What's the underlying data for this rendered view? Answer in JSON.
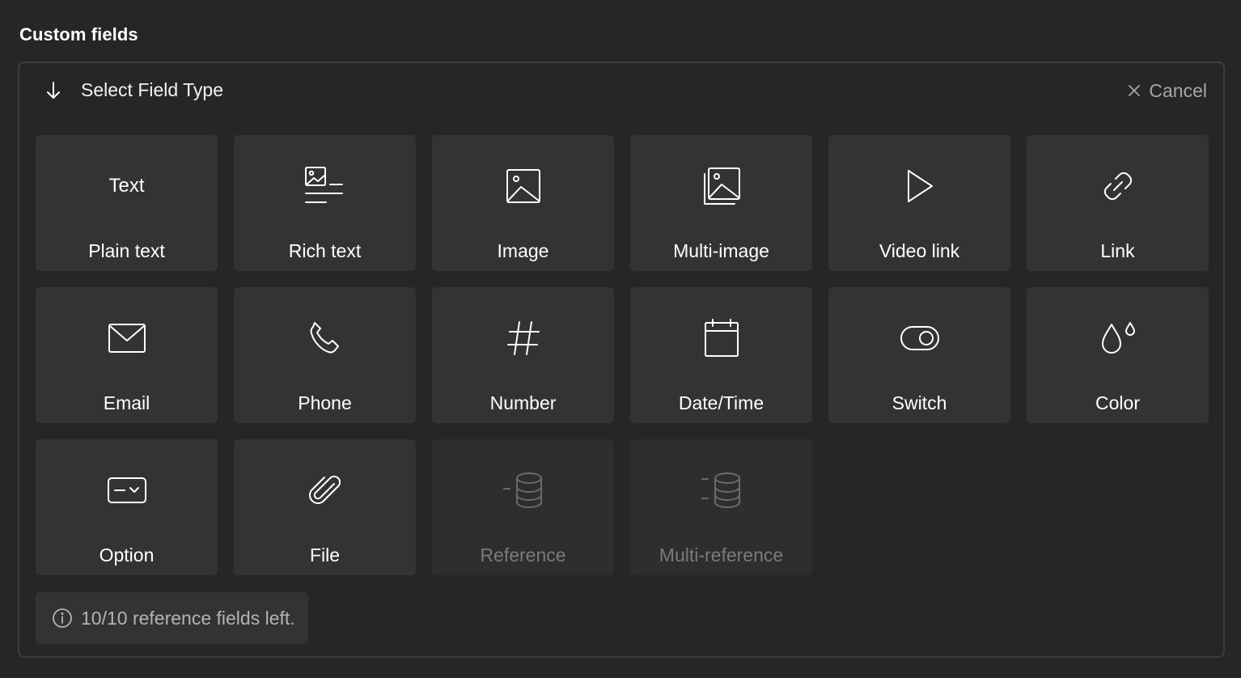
{
  "section_title": "Custom fields",
  "header": {
    "title": "Select Field Type",
    "arrow_icon": "arrow-down-icon",
    "cancel_label": "Cancel",
    "cancel_icon": "close-icon"
  },
  "field_types": [
    {
      "label": "Plain text",
      "icon": "text-icon",
      "icon_text": "Text",
      "enabled": true
    },
    {
      "label": "Rich text",
      "icon": "rich-text-icon",
      "enabled": true
    },
    {
      "label": "Image",
      "icon": "image-icon",
      "enabled": true
    },
    {
      "label": "Multi-image",
      "icon": "multi-image-icon",
      "enabled": true
    },
    {
      "label": "Video link",
      "icon": "play-icon",
      "enabled": true
    },
    {
      "label": "Link",
      "icon": "link-icon",
      "enabled": true
    },
    {
      "label": "Email",
      "icon": "envelope-icon",
      "enabled": true
    },
    {
      "label": "Phone",
      "icon": "phone-icon",
      "enabled": true
    },
    {
      "label": "Number",
      "icon": "hash-icon",
      "enabled": true
    },
    {
      "label": "Date/Time",
      "icon": "calendar-icon",
      "enabled": true
    },
    {
      "label": "Switch",
      "icon": "toggle-icon",
      "enabled": true
    },
    {
      "label": "Color",
      "icon": "droplets-icon",
      "enabled": true
    },
    {
      "label": "Option",
      "icon": "dropdown-icon",
      "enabled": true
    },
    {
      "label": "File",
      "icon": "paperclip-icon",
      "enabled": true
    },
    {
      "label": "Reference",
      "icon": "database-reference-icon",
      "enabled": false
    },
    {
      "label": "Multi-reference",
      "icon": "database-multi-reference-icon",
      "enabled": false
    }
  ],
  "info": {
    "icon": "info-icon",
    "text": "10/10 reference fields left."
  },
  "colors": {
    "background": "#262626",
    "tile": "#333333",
    "tile_disabled": "#2e2e2e",
    "border": "#3d3d3d",
    "muted_text": "#a6a6a6",
    "disabled_text": "#7a7a7a"
  }
}
